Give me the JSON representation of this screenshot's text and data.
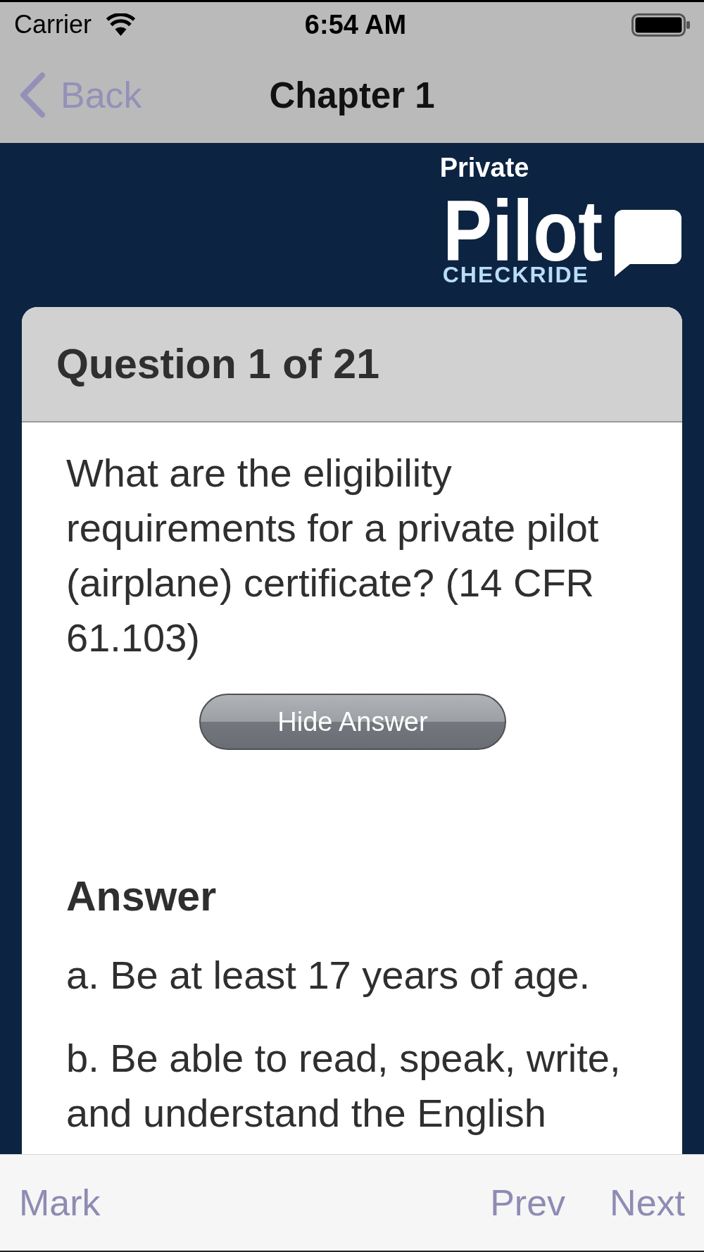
{
  "status_bar": {
    "carrier": "Carrier",
    "time": "6:54 AM"
  },
  "nav_bar": {
    "back": "Back",
    "title": "Chapter 1"
  },
  "logo": {
    "top": "Private",
    "main": "Pilot",
    "tagline": "CHECKRIDE"
  },
  "question_card": {
    "header": "Question 1 of 21",
    "question": "What are the eligibility requirements for a private pilot (airplane) certificate? (14 CFR 61.103)",
    "toggle_button": "Hide Answer",
    "answer_heading": "Answer",
    "answer_items": [
      "a. Be at least 17 years of age.",
      "b. Be able to read, speak, write, and understand the English"
    ]
  },
  "toolbar": {
    "left_buttons": [
      "Mark"
    ],
    "right_buttons": [
      "Prev",
      "Next"
    ]
  }
}
